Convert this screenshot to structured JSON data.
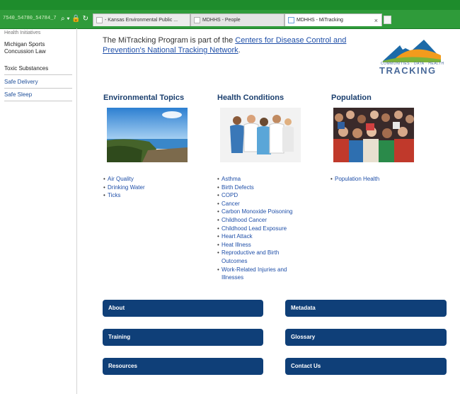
{
  "browser": {
    "address_text": "7540_54780_54784_7",
    "tabs": [
      {
        "label": "- Kansas Environmental Public ..."
      },
      {
        "label": "MDHHS - People"
      },
      {
        "label": "MDHHS - MiTracking",
        "close": "×"
      }
    ]
  },
  "sidebar": {
    "cut_item": "Health Initiatives",
    "items": [
      {
        "label": "Michigan Sports Concussion Law"
      },
      {
        "label": "Toxic Substances"
      },
      {
        "label": "Safe Delivery"
      },
      {
        "label": "Safe Sleep"
      }
    ]
  },
  "intro": {
    "text": "The MiTracking Program is part of the ",
    "link": "Centers for Disease Control and Prevention's National Tracking Network",
    "end": "."
  },
  "logo": {
    "tagline": "COMMUNITIES · DATA · HEALTH",
    "word": "TRACKING"
  },
  "columns": [
    {
      "heading": "Environmental Topics",
      "image": "lake-shoreline-photo",
      "links": [
        "Air Quality",
        "Drinking Water",
        "Ticks"
      ]
    },
    {
      "heading": "Health Conditions",
      "image": "healthcare-workers-photo",
      "links": [
        "Asthma",
        "Birth Defects",
        "COPD",
        "Cancer",
        "Carbon Monoxide Poisoning",
        "Childhood Cancer",
        "Childhood Lead Exposure",
        "Heart Attack",
        "Heat Illness",
        "Reproductive and Birth Outcomes",
        "Work-Related Injuries and Illnesses"
      ]
    },
    {
      "heading": "Population",
      "image": "crowd-photo",
      "links": [
        "Population Health"
      ]
    }
  ],
  "nav_buttons": {
    "left": [
      "About",
      "Training",
      "Resources"
    ],
    "right": [
      "Metadata",
      "Glossary",
      "Contact Us"
    ]
  },
  "colors": {
    "button_bg": "#0f3f78",
    "heading": "#1b3f6e",
    "link": "#1f4fa8",
    "browser_green": "#2f9b3a"
  }
}
